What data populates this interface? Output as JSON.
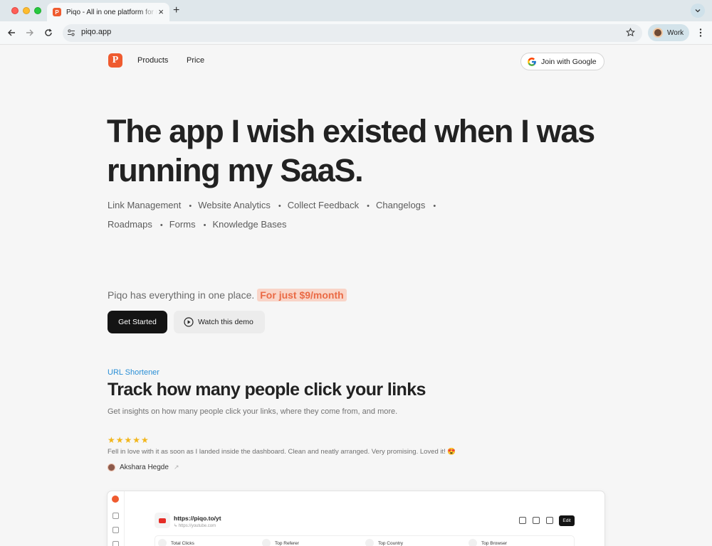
{
  "browser": {
    "tab_title": "Piqo - All in one platform for makers",
    "tab_favicon": "P",
    "url": "piqo.app",
    "profile_name": "Work"
  },
  "nav": {
    "logo": "P",
    "links": [
      "Products",
      "Price"
    ],
    "google_button": "Join with Google"
  },
  "hero": {
    "title": "The app I wish existed when I was running my SaaS.",
    "features": [
      "Link Management",
      "Website Analytics",
      "Collect Feedback",
      "Changelogs",
      "Roadmaps",
      "Forms",
      "Knowledge Bases"
    ],
    "tagline": "Piqo has everything in one place.",
    "price_highlight": "For just $9/month",
    "cta_primary": "Get Started",
    "cta_secondary": "Watch this demo"
  },
  "section": {
    "kicker": "URL Shortener",
    "title": "Track how many people click your links",
    "subtitle": "Get insights on how many people click your links, where they come from, and more."
  },
  "testimonial": {
    "stars": "★★★★★",
    "rating": 5,
    "text": "Fell in love with it as soon as I landed inside the dashboard. Clean and neatly arranged. Very promising. Loved it! 😍",
    "author": "Akshara Hegde"
  },
  "dashboard": {
    "short_url": "https://piqo.to/yt",
    "long_url": "https://youtube.com",
    "edit_label": "Edit",
    "stats": [
      "Total Clicks",
      "Top Referer",
      "Top Country",
      "Top Browser"
    ]
  },
  "colors": {
    "brand": "#ef5b2f",
    "price_highlight_bg": "#f9d4c7",
    "price_highlight_text": "#ea6a45",
    "kicker": "#2a8fd6",
    "stars": "#f2b61c"
  }
}
